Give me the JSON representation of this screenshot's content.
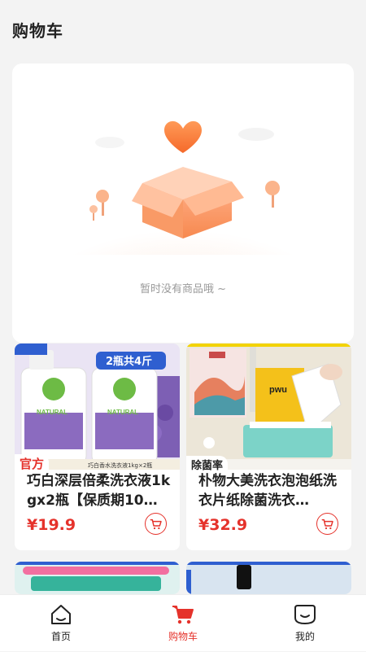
{
  "header": {
    "title": "购物车"
  },
  "empty_state": {
    "message": "暂时没有商品哦 ~"
  },
  "products": [
    {
      "badge": "官方",
      "title": "巧白深层倍柔洗衣液1kgx2瓶【保质期10…",
      "price": "¥19.9",
      "image_texts": [
        "NATURAL",
        "2瓶共4斤",
        "巧白香水洗衣液1kg×2瓶"
      ]
    },
    {
      "badge": "除菌率",
      "title": "朴物大美洗衣泡泡纸洗衣片纸除菌洗衣…",
      "price": "¥32.9",
      "image_texts": [
        "pwu"
      ]
    }
  ],
  "tabbar": {
    "items": [
      {
        "label": "首页",
        "icon": "home-icon"
      },
      {
        "label": "购物车",
        "icon": "cart-icon"
      },
      {
        "label": "我的",
        "icon": "profile-icon"
      }
    ],
    "active_index": 1
  },
  "colors": {
    "accent": "#e5322b",
    "background": "#f3f3f3",
    "illustration_orange": "#f7935c"
  }
}
